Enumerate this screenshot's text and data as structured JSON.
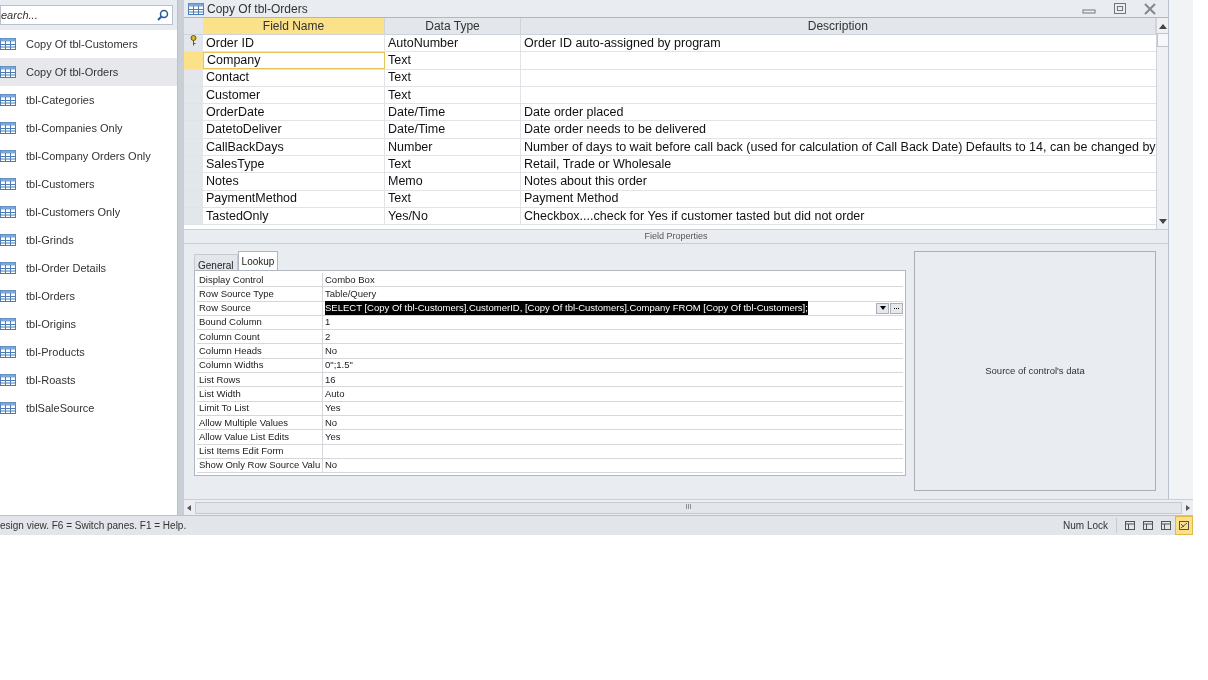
{
  "nav_pane": {
    "search": {
      "placeholder": "earch..."
    },
    "items": [
      {
        "label": "Copy Of tbl-Customers",
        "selected": false
      },
      {
        "label": "Copy Of tbl-Orders",
        "selected": true
      },
      {
        "label": "tbl-Categories",
        "selected": false
      },
      {
        "label": "tbl-Companies Only",
        "selected": false
      },
      {
        "label": "tbl-Company Orders Only",
        "selected": false
      },
      {
        "label": "tbl-Customers",
        "selected": false
      },
      {
        "label": "tbl-Customers Only",
        "selected": false
      },
      {
        "label": "tbl-Grinds",
        "selected": false
      },
      {
        "label": "tbl-Order Details",
        "selected": false
      },
      {
        "label": "tbl-Orders",
        "selected": false
      },
      {
        "label": "tbl-Origins",
        "selected": false
      },
      {
        "label": "tbl-Products",
        "selected": false
      },
      {
        "label": "tbl-Roasts",
        "selected": false
      },
      {
        "label": "tblSaleSource",
        "selected": false
      }
    ]
  },
  "document": {
    "title": "Copy Of tbl-Orders",
    "table": {
      "columns": [
        "Field Name",
        "Data Type",
        "Description"
      ],
      "rows": [
        {
          "field": "Order ID",
          "type": "AutoNumber",
          "description": "Order ID auto-assigned by program",
          "primary_key": true,
          "selected": false
        },
        {
          "field": "Company",
          "type": "Text",
          "primary_key": false,
          "selected": true
        },
        {
          "field": "Contact",
          "type": "Text",
          "primary_key": false,
          "selected": false
        },
        {
          "field": "Customer",
          "type": "Text",
          "primary_key": false,
          "selected": false
        },
        {
          "field": "OrderDate",
          "type": "Date/Time",
          "description": "Date order placed",
          "primary_key": false,
          "selected": false
        },
        {
          "field": "DatetoDeliver",
          "type": "Date/Time",
          "description": "Date order needs to be delivered",
          "primary_key": false,
          "selected": false
        },
        {
          "field": "CallBackDays",
          "type": "Number",
          "description": "Number of days to wait before call back (used for calculation of Call Back Date) Defaults to 14, can be changed by",
          "primary_key": false,
          "selected": false
        },
        {
          "field": "SalesType",
          "type": "Text",
          "description": "Retail, Trade or Wholesale",
          "primary_key": false,
          "selected": false
        },
        {
          "field": "Notes",
          "type": "Memo",
          "description": "Notes about this order",
          "primary_key": false,
          "selected": false
        },
        {
          "field": "PaymentMethod",
          "type": "Text",
          "description": "Payment Method",
          "primary_key": false,
          "selected": false
        },
        {
          "field": "TastedOnly",
          "type": "Yes/No",
          "description": "Checkbox....check for Yes if customer tasted but did not order",
          "primary_key": false,
          "selected": false
        }
      ]
    },
    "field_properties": {
      "title": "Field Properties",
      "tabs": [
        {
          "label": "General",
          "selected": false
        },
        {
          "label": "Lookup",
          "selected": true
        }
      ],
      "properties": [
        {
          "name": "Display Control",
          "value": "Combo Box",
          "selected": false
        },
        {
          "name": "Row Source Type",
          "value": "Table/Query",
          "selected": false
        },
        {
          "name": "Row Source",
          "value": "SELECT [Copy Of tbl-Customers].CustomerID, [Copy Of tbl-Customers].Company FROM [Copy Of tbl-Customers];",
          "selected": true
        },
        {
          "name": "Bound Column",
          "value": "1",
          "selected": false
        },
        {
          "name": "Column Count",
          "value": "2",
          "selected": false
        },
        {
          "name": "Column Heads",
          "value": "No",
          "selected": false
        },
        {
          "name": "Column Widths",
          "value": "0\";1.5\"",
          "selected": false
        },
        {
          "name": "List Rows",
          "value": "16",
          "selected": false
        },
        {
          "name": "List Width",
          "value": "Auto",
          "selected": false
        },
        {
          "name": "Limit To List",
          "value": "Yes",
          "selected": false
        },
        {
          "name": "Allow Multiple Values",
          "value": "No",
          "selected": false
        },
        {
          "name": "Allow Value List Edits",
          "value": "Yes",
          "selected": false
        },
        {
          "name": "List Items Edit Form",
          "selected": false
        },
        {
          "name": "Show Only Row Source Valu",
          "value": "No",
          "selected": false
        }
      ],
      "help": "Source of control's data"
    },
    "scroll_thumb": "III"
  },
  "status_bar": {
    "message": "esign view.  F6 = Switch panes.  F1 = Help.",
    "num_lock": "Num Lock",
    "views": [
      {
        "selected": false
      },
      {
        "selected": false
      },
      {
        "selected": false
      },
      {
        "selected": true
      }
    ]
  }
}
